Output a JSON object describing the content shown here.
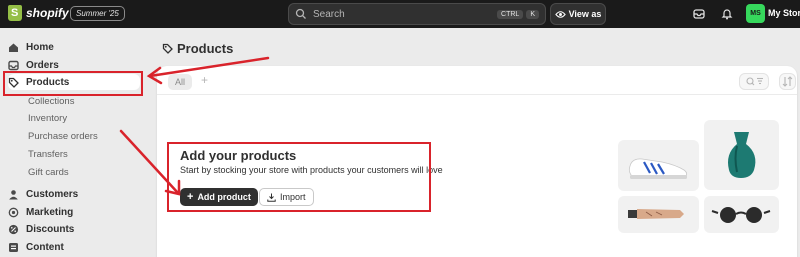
{
  "topbar": {
    "brand": "shopify",
    "edition": "Summer '25",
    "search_placeholder": "Search",
    "shortcut_keys": [
      "CTRL",
      "K"
    ],
    "view_as_label": "View as",
    "avatar_initials": "MS",
    "store_name": "My Store"
  },
  "sidebar": {
    "items": [
      {
        "label": "Home",
        "icon": "home-icon"
      },
      {
        "label": "Orders",
        "icon": "inbox-icon"
      },
      {
        "label": "Products",
        "icon": "tag-icon",
        "active": true
      },
      {
        "label": "Customers",
        "icon": "person-icon"
      },
      {
        "label": "Marketing",
        "icon": "target-icon"
      },
      {
        "label": "Discounts",
        "icon": "discount-icon"
      },
      {
        "label": "Content",
        "icon": "content-icon"
      }
    ],
    "product_subitems": [
      "Collections",
      "Inventory",
      "Purchase orders",
      "Transfers",
      "Gift cards"
    ]
  },
  "main": {
    "page_title": "Products",
    "tabs": [
      "All"
    ],
    "empty_state": {
      "title": "Add your products",
      "subtitle": "Start by stocking your store with products your customers will love",
      "primary_button": "Add product",
      "secondary_button": "Import"
    }
  },
  "colors": {
    "annotation_red": "#d9232b",
    "topbar_bg": "#1a1a1a",
    "brand_green": "#95bf47",
    "avatar_green": "#36d85c"
  }
}
